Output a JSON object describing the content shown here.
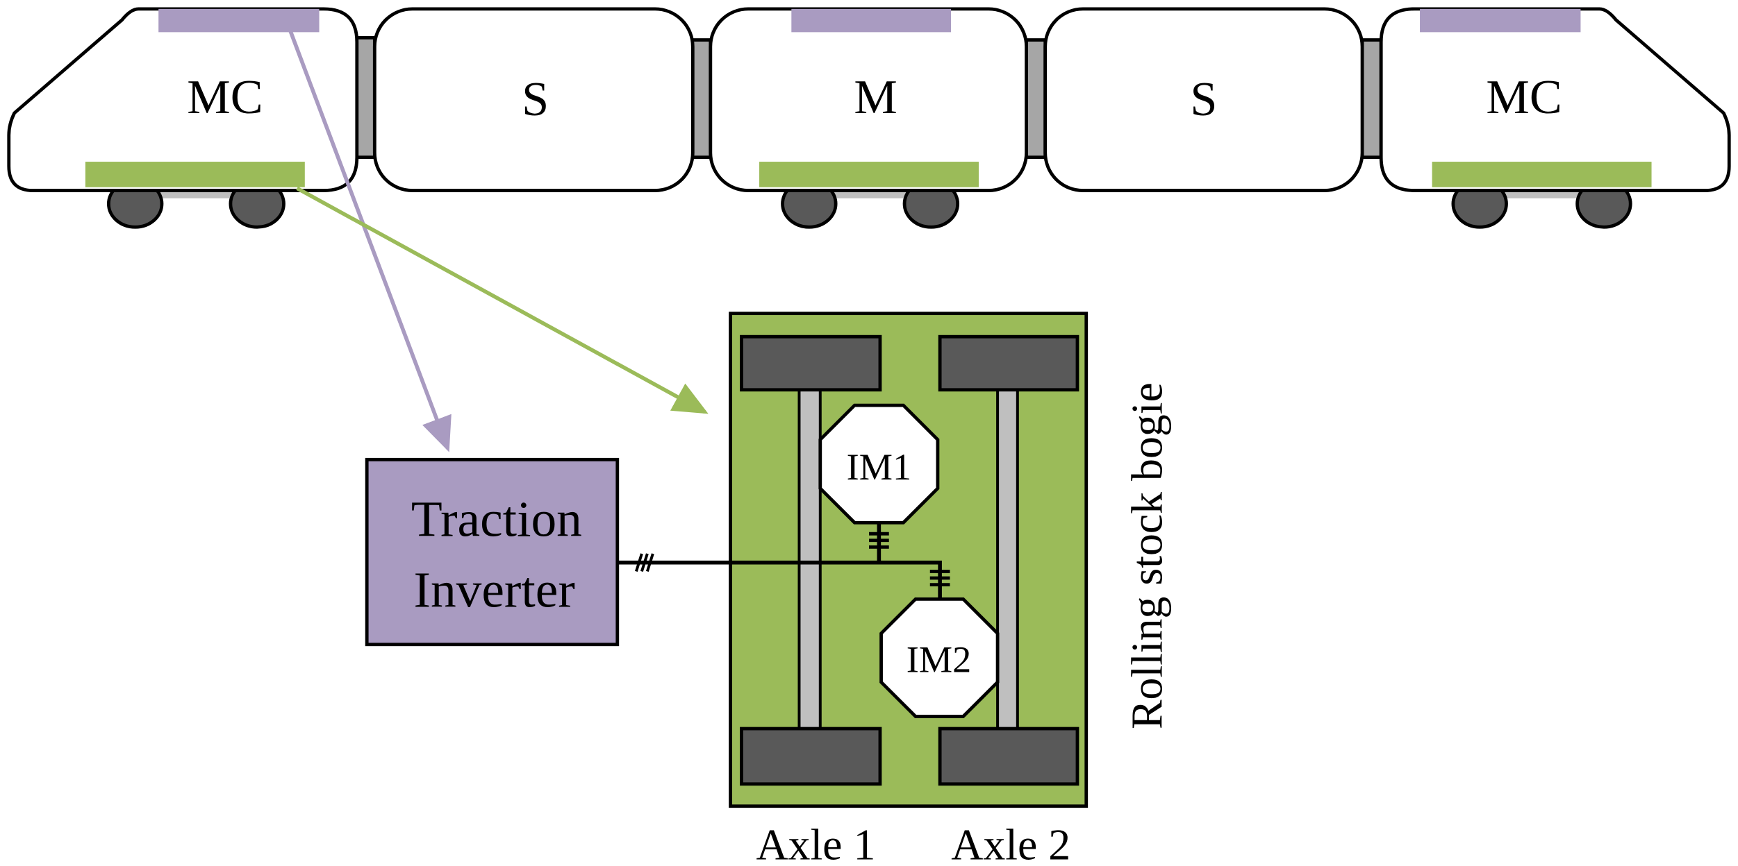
{
  "train": {
    "cars": [
      {
        "label": "MC"
      },
      {
        "label": "S"
      },
      {
        "label": "M"
      },
      {
        "label": "S"
      },
      {
        "label": "MC"
      }
    ]
  },
  "inverter": {
    "line1": "Traction",
    "line2": "Inverter"
  },
  "bogie": {
    "motor1": "IM1",
    "motor2": "IM2",
    "axle1": "Axle 1",
    "axle2": "Axle 2",
    "title": "Rolling stock bogie"
  },
  "colors": {
    "inverter": "#a99bc1",
    "bogie": "#9bbb59",
    "wheel": "#595959",
    "axle": "#bfbfbf",
    "coupler": "#a6a6a6"
  }
}
